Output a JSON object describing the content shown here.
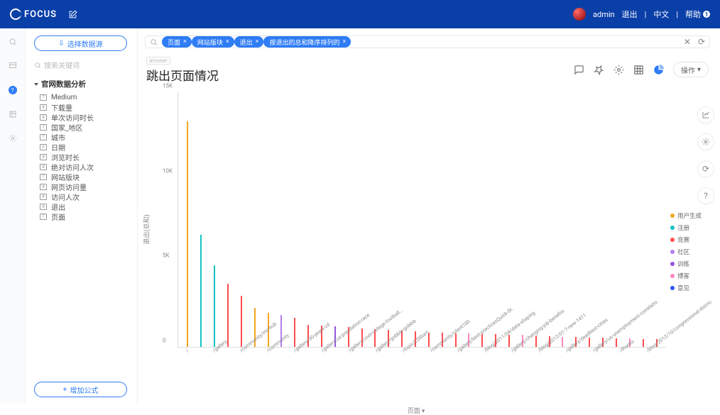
{
  "app": {
    "name": "FOCUS"
  },
  "topbar": {
    "user": "admin",
    "logout": "退出",
    "lang": "中文",
    "help": "帮助",
    "help_count": "1"
  },
  "sidebar": {
    "select_source": "选择数据源",
    "search_placeholder": "搜索关键词",
    "group": "官网数据分析",
    "fields": [
      {
        "icon": "T",
        "label": "Medium"
      },
      {
        "icon": "#",
        "label": "下载量"
      },
      {
        "icon": "#",
        "label": "单次访问时长"
      },
      {
        "icon": "T",
        "label": "国家_地区"
      },
      {
        "icon": "T",
        "label": "城市"
      },
      {
        "icon": "d",
        "label": "日期"
      },
      {
        "icon": "#",
        "label": "浏览时长"
      },
      {
        "icon": "#",
        "label": "绝对访问人次"
      },
      {
        "icon": "T",
        "label": "网站版块"
      },
      {
        "icon": "#",
        "label": "网页访问量"
      },
      {
        "icon": "#",
        "label": "访问人次"
      },
      {
        "icon": "#",
        "label": "退出"
      },
      {
        "icon": "T",
        "label": "页面"
      }
    ],
    "add_formula": "增加公式"
  },
  "query": {
    "chips": [
      "页面",
      "网站版块",
      "退出",
      "按退出的总和降序排列的"
    ],
    "answer_tag": "answer",
    "title": "跳出页面情况",
    "ops": "操作"
  },
  "legend_items": [
    {
      "label": "用户生成",
      "color": "#f5a623"
    },
    {
      "label": "注册",
      "color": "#13c2c2"
    },
    {
      "label": "竞赛",
      "color": "#ff4d4f"
    },
    {
      "label": "社区",
      "color": "#b37feb"
    },
    {
      "label": "训练",
      "color": "#9254de"
    },
    {
      "label": "博客",
      "color": "#ff85c0"
    },
    {
      "label": "意见",
      "color": "#2f54eb"
    }
  ],
  "colors": {
    "用户生成": "#f5a623",
    "注册": "#13c2c2",
    "竞赛": "#ff4d4f",
    "社区": "#b37feb",
    "训练": "#9254de",
    "博客": "#ff85c0",
    "意见": "#2f54eb"
  },
  "chart_data": {
    "type": "bar",
    "title": "跳出页面情况",
    "xlabel": "页面",
    "ylabel": "退出(总和)",
    "ylim": [
      0,
      15000
    ],
    "yticks": [
      0,
      5000,
      10000,
      15000
    ],
    "ytick_labels": [
      "0",
      "5K",
      "10K",
      "15K"
    ],
    "series_key": "网站版块",
    "data": [
      {
        "page": "/",
        "value": 13300,
        "seg": "用户生成"
      },
      {
        "page": "",
        "value": 6600,
        "seg": "注册"
      },
      {
        "page": "/gallery",
        "value": 4800,
        "seg": "注册"
      },
      {
        "page": "",
        "value": 3700,
        "seg": "竞赛"
      },
      {
        "page": "/community/my-hub",
        "value": 3000,
        "seg": "竞赛"
      },
      {
        "page": "",
        "value": 2300,
        "seg": "用户生成"
      },
      {
        "page": "/community",
        "value": 2000,
        "seg": "用户生成"
      },
      {
        "page": "",
        "value": 1900,
        "seg": "社区"
      },
      {
        "page": "/gallery/30-years-cd",
        "value": 1700,
        "seg": "竞赛"
      },
      {
        "page": "",
        "value": 1300,
        "seg": "竞赛"
      },
      {
        "page": "/gallery/us-population-race",
        "value": 1250,
        "seg": "竞赛"
      },
      {
        "page": "",
        "value": 1200,
        "seg": "训练"
      },
      {
        "page": "/gallery/cost-college-football...",
        "value": 1150,
        "seg": "竞赛"
      },
      {
        "page": "",
        "value": 1100,
        "seg": "竞赛"
      },
      {
        "page": "/gallery/gobble-gobble",
        "value": 1050,
        "seg": "竞赛"
      },
      {
        "page": "",
        "value": 1000,
        "seg": "竞赛"
      },
      {
        "page": "/topic/LDStart",
        "value": 950,
        "seg": "竞赛"
      },
      {
        "page": "",
        "value": 900,
        "seg": "竞赛"
      },
      {
        "page": "/community/silent100",
        "value": 850,
        "seg": "竞赛"
      },
      {
        "page": "",
        "value": 820,
        "seg": "竞赛"
      },
      {
        "page": "/gallery/best-practicesQuick-St.",
        "value": 800,
        "seg": "竞赛"
      },
      {
        "page": "",
        "value": 780,
        "seg": "博客"
      },
      {
        "page": "/blog/2011/04/data-shaping",
        "value": 760,
        "seg": "竞赛"
      },
      {
        "page": "",
        "value": 740,
        "seg": "竞赛"
      },
      {
        "page": "/gallery/changing-job-benefits",
        "value": 720,
        "seg": "竞赛"
      },
      {
        "page": "",
        "value": 700,
        "seg": "博客"
      },
      {
        "page": "/blog/2012/01-7-new-1411",
        "value": 650,
        "seg": "竞赛"
      },
      {
        "page": "",
        "value": 620,
        "seg": "竞赛"
      },
      {
        "page": "/gallery/deadliest-cities",
        "value": 600,
        "seg": "博客"
      },
      {
        "page": "",
        "value": 580,
        "seg": "竞赛"
      },
      {
        "page": "/gallery/us-unemployment-correlatio.",
        "value": 560,
        "seg": "竞赛"
      },
      {
        "page": "",
        "value": 540,
        "seg": "竞赛"
      },
      {
        "page": "/thanks",
        "value": 520,
        "seg": "竞赛"
      },
      {
        "page": "",
        "value": 500,
        "seg": "博客"
      },
      {
        "page": "/blog/2012/10/congressional-distric.",
        "value": 480,
        "seg": "竞赛"
      },
      {
        "page": "",
        "value": 460,
        "seg": "竞赛"
      }
    ]
  }
}
